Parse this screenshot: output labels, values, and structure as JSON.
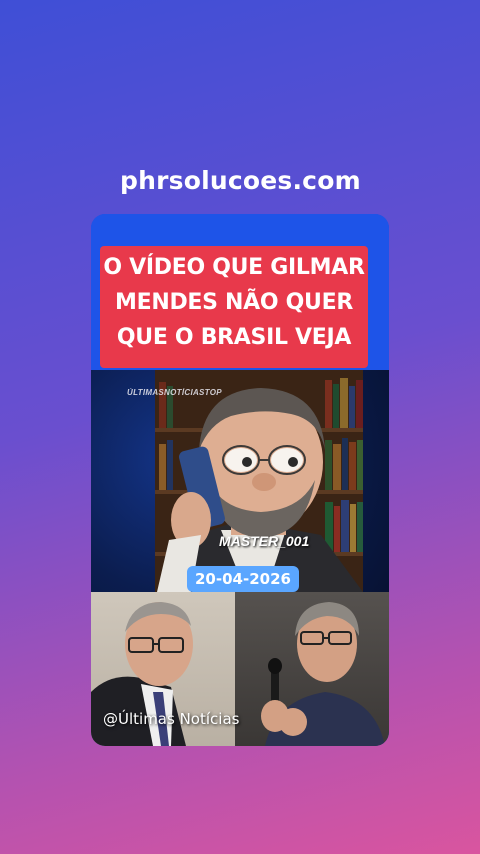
{
  "site": {
    "domain": "phrsolucoes.com"
  },
  "headline": {
    "lines": [
      "O VÍDEO QUE GILMAR",
      "MENDES NÃO QUER",
      "QUE O BRASIL VEJA"
    ]
  },
  "scene": {
    "watermark": "ÚLTIMASNOTÍCIASTOP",
    "caption": "MASTER_001"
  },
  "date_badge": {
    "text": "20-04-2026"
  },
  "credit": {
    "text": "@Últimas Notícias"
  }
}
